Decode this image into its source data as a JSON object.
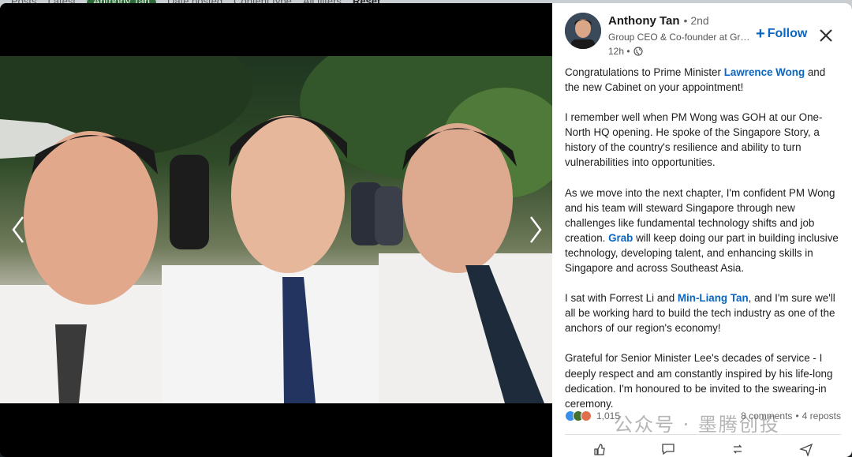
{
  "background_filters": [
    "Posts",
    "Latest",
    "Anthony Tan",
    "Date posted",
    "Content type",
    "All filters",
    "Reset"
  ],
  "author": {
    "name": "Anthony Tan",
    "degree": "• 2nd",
    "headline": "Group CEO & Co-founder at Grab",
    "time": "12h •",
    "follow_label": "Follow"
  },
  "post": {
    "p1_a": "Congratulations to Prime Minister ",
    "p1_mention": "Lawrence Wong",
    "p1_b": " and the new Cabinet on your appointment!",
    "p2": "I remember well when PM Wong was GOH at our One-North HQ opening. He spoke of the Singapore Story, a history of the country's resilience and ability to turn vulnerabilities into opportunities.",
    "p3_a": "As we move into the next chapter, I'm confident PM Wong and his team will steward Singapore through new challenges like fundamental technology shifts and job creation. ",
    "p3_mention": "Grab",
    "p3_b": " will keep doing our part in building inclusive technology, developing talent, and enhancing skills in Singapore and across Southeast Asia.",
    "p4_a": "I sat with Forrest Li and ",
    "p4_mention": "Min-Liang Tan",
    "p4_b": ", and I'm sure we'll all be working hard to build the tech industry as one of the anchors of our region's economy!",
    "p5": "Grateful for Senior Minister Lee's decades of service - I deeply respect and am constantly inspired by his life-long dedication. I'm honoured to be invited to the swearing-in ceremony."
  },
  "social": {
    "reactions": "1,015",
    "comments": "8 comments",
    "separator": "•",
    "reposts": "4 reposts"
  },
  "watermark": "公众号 · 墨腾创投",
  "colors": {
    "link": "#0a66c2",
    "lightbox_bg": "#000000"
  }
}
